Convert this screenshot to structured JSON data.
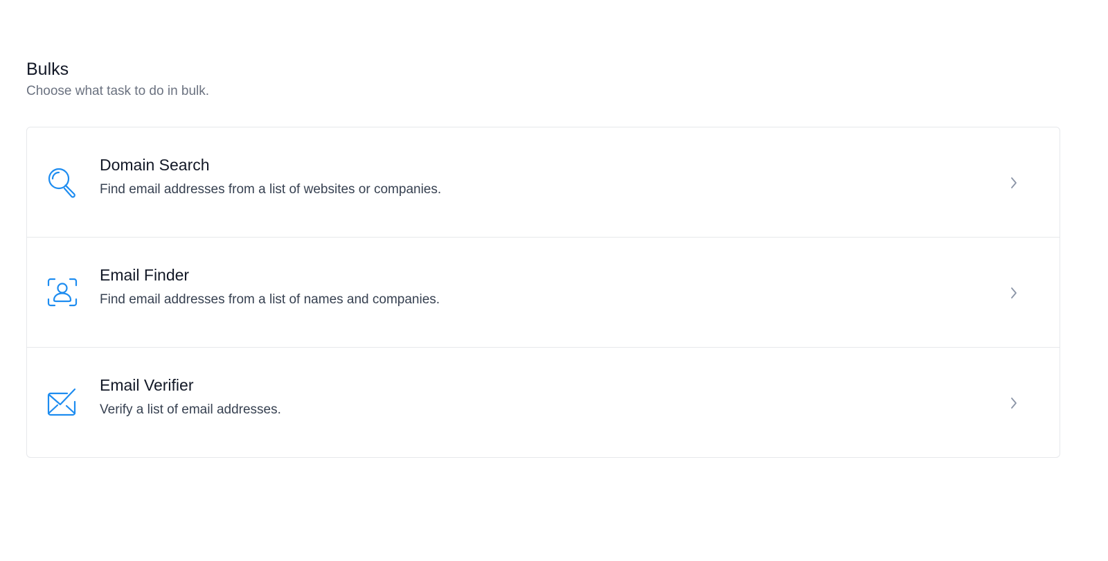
{
  "header": {
    "title": "Bulks",
    "subtitle": "Choose what task to do in bulk."
  },
  "tasks": [
    {
      "name": "Domain Search",
      "description": "Find email addresses from a list of websites or companies.",
      "icon": "magnifier-icon"
    },
    {
      "name": "Email Finder",
      "description": "Find email addresses from a list of names and companies.",
      "icon": "person-scan-icon"
    },
    {
      "name": "Email Verifier",
      "description": "Verify a list of email addresses.",
      "icon": "envelope-check-icon"
    }
  ],
  "colors": {
    "accent": "#1d8cf0",
    "chevron": "#8a94a6",
    "border": "#e6e8eb"
  }
}
